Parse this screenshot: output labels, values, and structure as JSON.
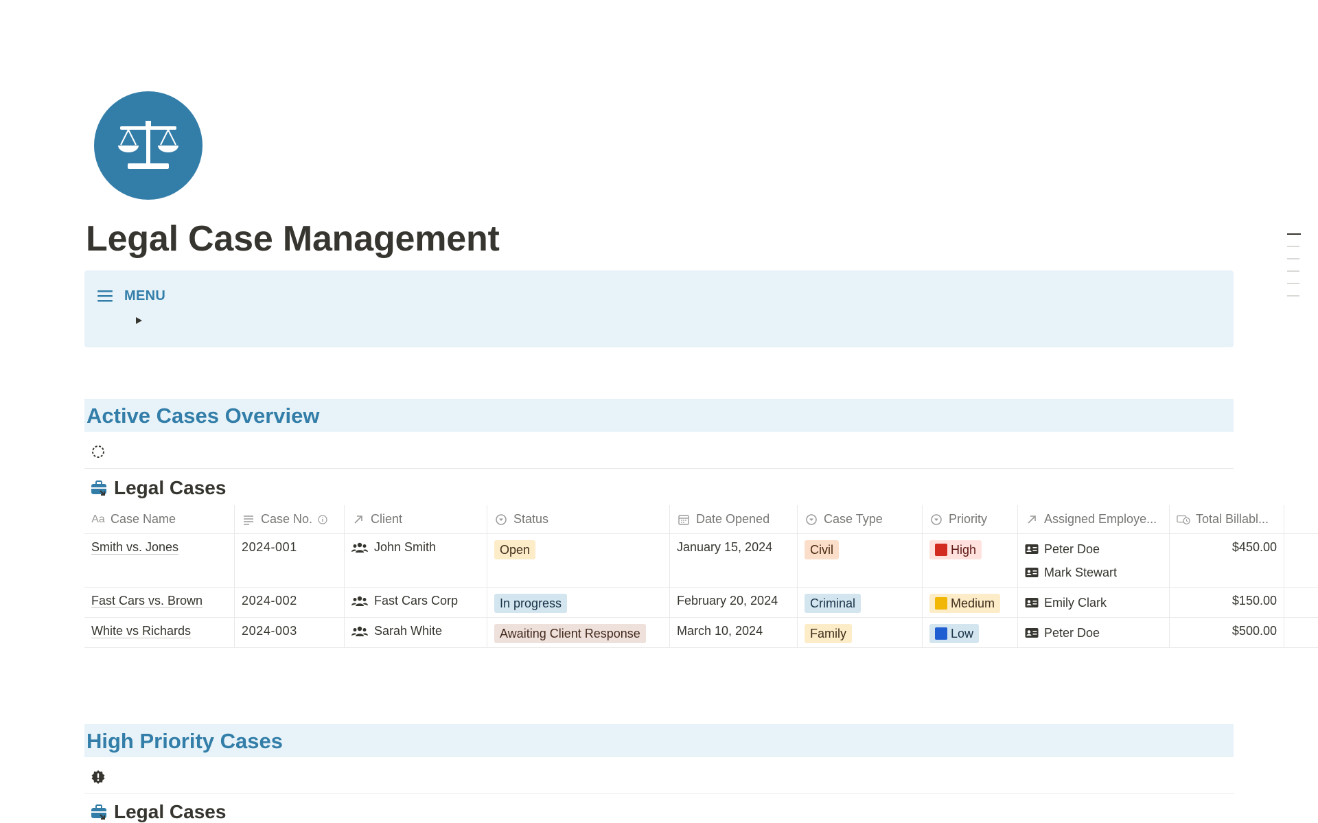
{
  "page": {
    "title": "Legal Case Management",
    "icon": "scales-of-justice-icon",
    "accent_color": "#337ea9"
  },
  "menu": {
    "label": "MENU",
    "icon": "hamburger-menu-icon",
    "toggle_icon": "triangle-right-icon"
  },
  "sections": [
    {
      "heading": "Active Cases Overview",
      "icon": "dashed-circle-icon"
    },
    {
      "heading": "High Priority Cases",
      "icon": "alert-badge-icon"
    }
  ],
  "database": {
    "title": "Legal Cases",
    "icon": "briefcase-link-icon",
    "columns": [
      {
        "label": "Case Name",
        "icon": "Aa"
      },
      {
        "label": "Case No.",
        "icon": "text-lines-icon"
      },
      {
        "label": "Client",
        "icon": "relation-arrow-icon"
      },
      {
        "label": "Status",
        "icon": "status-icon"
      },
      {
        "label": "Date Opened",
        "icon": "calendar-icon"
      },
      {
        "label": "Case Type",
        "icon": "select-icon"
      },
      {
        "label": "Priority",
        "icon": "select-icon"
      },
      {
        "label": "Assigned Employe...",
        "icon": "relation-arrow-icon"
      },
      {
        "label": "Total Billabl...",
        "icon": "rollup-icon"
      }
    ],
    "rows": [
      {
        "case_name": "Smith vs. Jones",
        "case_no": "2024-001",
        "client": "John Smith",
        "status": "Open",
        "date_opened": "January 15, 2024",
        "case_type": "Civil",
        "priority": "High",
        "assigned": [
          "Peter Doe",
          "Mark Stewart"
        ],
        "total_billable": "$450.00"
      },
      {
        "case_name": "Fast Cars vs. Brown",
        "case_no": "2024-002",
        "client": "Fast Cars Corp",
        "status": "In progress",
        "date_opened": "February 20, 2024",
        "case_type": "Criminal",
        "priority": "Medium",
        "assigned": [
          "Emily Clark"
        ],
        "total_billable": "$150.00"
      },
      {
        "case_name": "White vs Richards",
        "case_no": "2024-003",
        "client": "Sarah White",
        "status": "Awaiting Client Response",
        "date_opened": "March 10, 2024",
        "case_type": "Family",
        "priority": "Low",
        "assigned": [
          "Peter Doe"
        ],
        "total_billable": "$500.00"
      }
    ]
  }
}
